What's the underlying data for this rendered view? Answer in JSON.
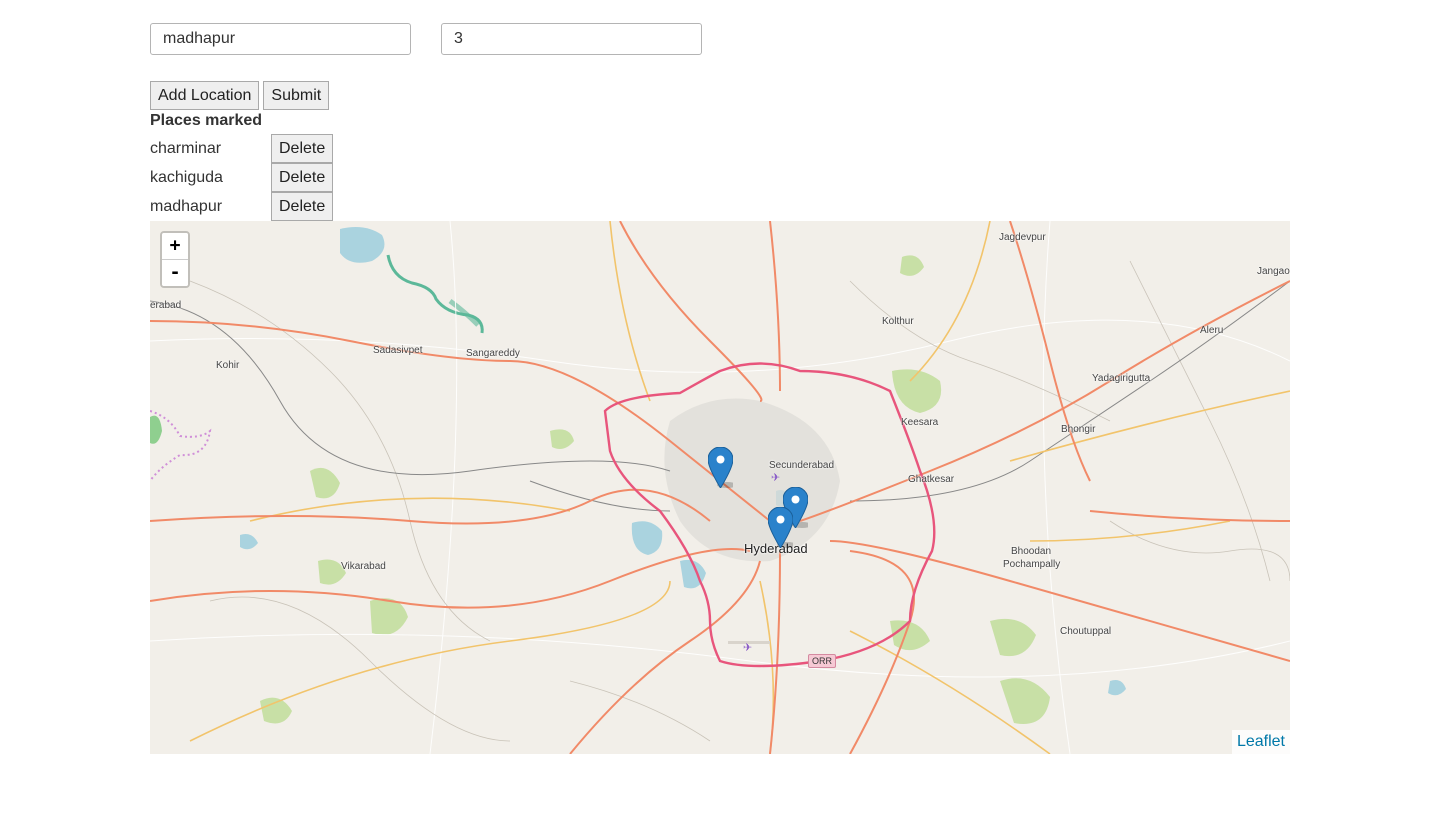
{
  "form": {
    "location_value": "madhapur",
    "count_value": "3",
    "add_location_label": "Add Location",
    "submit_label": "Submit"
  },
  "places": {
    "heading": "Places marked",
    "items": [
      {
        "name": "charminar",
        "delete_label": "Delete"
      },
      {
        "name": "kachiguda",
        "delete_label": "Delete"
      },
      {
        "name": "madhapur",
        "delete_label": "Delete"
      }
    ]
  },
  "map": {
    "zoom_in_label": "+",
    "zoom_out_label": "-",
    "attribution": "Leaflet",
    "labels": {
      "jagdevpur": "Jagdevpur",
      "jangaon": "Jangao",
      "erabad": "erabad",
      "kolthur": "Kolthur",
      "aleru": "Aleru",
      "sadasivpet": "Sadasivpet",
      "sangareddy": "Sangareddy",
      "kohir": "Kohir",
      "yadagirigutta": "Yadagirigutta",
      "keesara": "Keesara",
      "bhongir": "Bhongir",
      "secunderabad": "Secunderabad",
      "ghatkesar": "Ghatkesar",
      "hyderabad": "Hyderabad",
      "bhoodan": "Bhoodan",
      "pochampally": "Pochampally",
      "vikarabad": "Vikarabad",
      "choutuppal": "Choutuppal",
      "orr": "ORR"
    },
    "markers": [
      "madhapur",
      "kachiguda",
      "charminar"
    ]
  },
  "colors": {
    "map_background": "#f2efe9",
    "ring_road": "#e8557c",
    "primary_road": "#f18a68",
    "secondary_road": "#f2c46b",
    "water": "#aad3df",
    "green": "#c8e0a6",
    "marker": "#2a82cb",
    "link": "#0078a8"
  }
}
